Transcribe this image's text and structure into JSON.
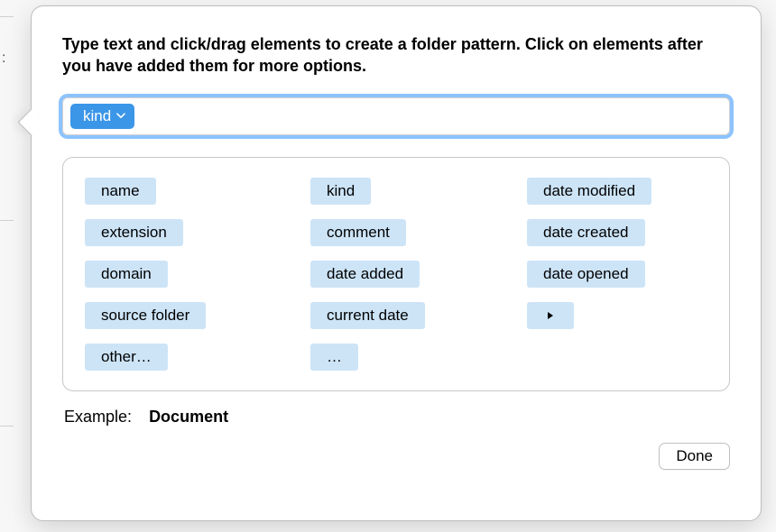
{
  "instructions": "Type text and click/drag elements to create a folder pattern. Click on elements after you have added them for more options.",
  "pattern": {
    "tokens": [
      {
        "label": "kind"
      }
    ]
  },
  "palette": {
    "items": {
      "r0c0": "name",
      "r0c1": "kind",
      "r0c2": "date modified",
      "r1c0": "extension",
      "r1c1": "comment",
      "r1c2": "date created",
      "r2c0": "domain",
      "r2c1": "date added",
      "r2c2": "date opened",
      "r3c0": "source folder",
      "r3c1": "current date",
      "r4c0": "other…",
      "r4c1": "…"
    }
  },
  "example": {
    "label": "Example:",
    "value": "Document"
  },
  "buttons": {
    "done": "Done"
  },
  "side_label": ":"
}
